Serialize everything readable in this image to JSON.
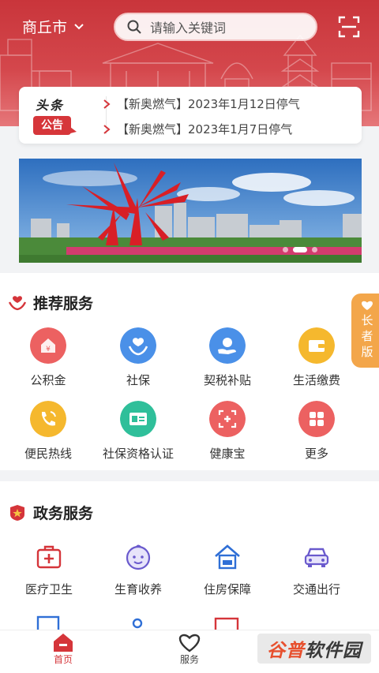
{
  "header": {
    "city": "商丘市",
    "search_placeholder": "请输入关键词"
  },
  "notice": {
    "badge_top": "头条",
    "badge_bottom": "公告",
    "items": [
      {
        "text": "【新奥燃气】2023年1月12日停气"
      },
      {
        "text": "【新奥燃气】2023年1月7日停气"
      }
    ]
  },
  "banner": {
    "slide_count": 3,
    "active_slide": 1
  },
  "recommended": {
    "title": "推荐服务",
    "items": [
      {
        "label": "公积金",
        "icon": "housing-fund-icon",
        "color": "#ec5b5b"
      },
      {
        "label": "社保",
        "icon": "social-security-icon",
        "color": "#4a90e8"
      },
      {
        "label": "契税补贴",
        "icon": "tax-subsidy-icon",
        "color": "#4a90e8"
      },
      {
        "label": "生活缴费",
        "icon": "wallet-icon",
        "color": "#f5b82e"
      },
      {
        "label": "便民热线",
        "icon": "hotline-icon",
        "color": "#f5b82e"
      },
      {
        "label": "社保资格认证",
        "icon": "id-card-icon",
        "color": "#2fbf9a"
      },
      {
        "label": "健康宝",
        "icon": "health-code-icon",
        "color": "#ec5b5b"
      },
      {
        "label": "更多",
        "icon": "more-grid-icon",
        "color": "#ec5b5b"
      }
    ]
  },
  "government": {
    "title": "政务服务",
    "items": [
      {
        "label": "医疗卫生",
        "icon": "medical-kit-icon",
        "color": "#d5353a"
      },
      {
        "label": "生育收养",
        "icon": "baby-face-icon",
        "color": "#6a5acd"
      },
      {
        "label": "住房保障",
        "icon": "house-icon",
        "color": "#2f6fd6"
      },
      {
        "label": "交通出行",
        "icon": "car-icon",
        "color": "#6a5acd"
      }
    ]
  },
  "elder_mode": {
    "label": "长者版"
  },
  "tabbar": {
    "tabs": [
      {
        "label": "首页",
        "icon": "home-icon",
        "active": true
      },
      {
        "label": "服务",
        "icon": "heart-icon",
        "active": false
      }
    ]
  },
  "watermark": {
    "part1": "谷普",
    "part2": "软件园"
  },
  "colors": {
    "primary": "#d5353a",
    "accent": "#f3a64a"
  }
}
